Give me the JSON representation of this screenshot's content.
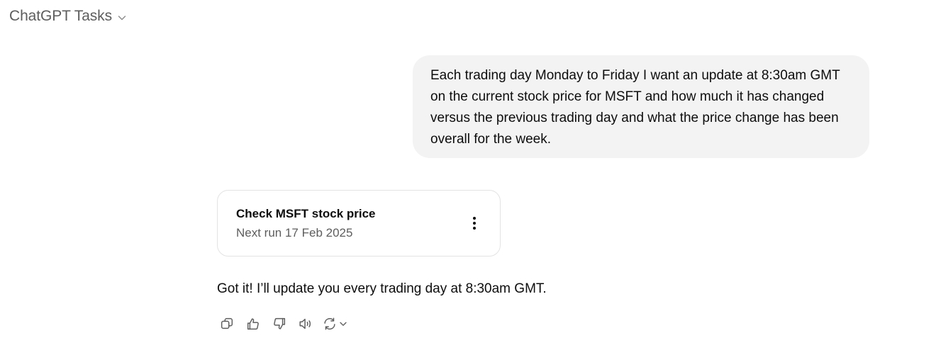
{
  "header": {
    "model_name": "ChatGPT Tasks",
    "dropdown_icon": "chevron-down-icon"
  },
  "conversation": {
    "user_message": "Each trading day Monday to Friday I want an update at 8:30am GMT on the current stock price for MSFT and how much it has changed versus the previous trading day and what the price change has been overall for the week.",
    "task_card": {
      "title": "Check MSFT stock price",
      "subtitle": "Next run 17 Feb 2025",
      "menu_icon": "more-vertical-icon"
    },
    "assistant_message": "Got it! I’ll update you every trading day at 8:30am GMT."
  },
  "message_actions": [
    {
      "icon": "copy-icon"
    },
    {
      "icon": "thumbs-up-icon"
    },
    {
      "icon": "thumbs-down-icon"
    },
    {
      "icon": "read-aloud-icon"
    },
    {
      "icon": "regenerate-icon"
    }
  ],
  "colors": {
    "bubble_bg": "#f3f3f3",
    "muted_text": "#5d5d5d",
    "card_border": "#e3e3e3"
  }
}
